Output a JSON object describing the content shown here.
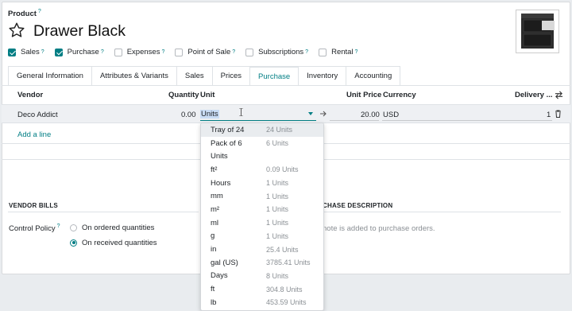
{
  "header": {
    "product_label": "Product",
    "help_mark": "?",
    "title": "Drawer Black"
  },
  "options": [
    {
      "label": "Sales",
      "checked": true
    },
    {
      "label": "Purchase",
      "checked": true
    },
    {
      "label": "Expenses",
      "checked": false
    },
    {
      "label": "Point of Sale",
      "checked": false
    },
    {
      "label": "Subscriptions",
      "checked": false
    },
    {
      "label": "Rental",
      "checked": false
    }
  ],
  "tabs": [
    "General Information",
    "Attributes & Variants",
    "Sales",
    "Prices",
    "Purchase",
    "Inventory",
    "Accounting"
  ],
  "active_tab": "Purchase",
  "table": {
    "headers": {
      "vendor": "Vendor",
      "quantity": "Quantity",
      "unit": "Unit",
      "unit_price": "Unit Price",
      "currency": "Currency",
      "delivery": "Delivery ..."
    },
    "row": {
      "vendor": "Deco Addict",
      "quantity": "0.00",
      "unit": "Units",
      "unit_price": "20.00",
      "currency": "USD",
      "delivery": "1"
    },
    "add_line": "Add a line"
  },
  "vendor_bills": {
    "title": "VENDOR BILLS",
    "control_policy_label": "Control Policy",
    "options": [
      "On ordered quantities",
      "On received quantities"
    ],
    "selected": "On received quantities"
  },
  "purchase_description": {
    "title_visible": "CHASE DESCRIPTION",
    "note_visible": "note is added to purchase orders."
  },
  "unit_dropdown": [
    {
      "name": "Tray of 24",
      "note": "24 Units"
    },
    {
      "name": "Pack of 6",
      "note": "6 Units"
    },
    {
      "name": "Units",
      "note": ""
    },
    {
      "name": "ft²",
      "note": "0.09 Units"
    },
    {
      "name": "Hours",
      "note": "1 Units"
    },
    {
      "name": "mm",
      "note": "1 Units"
    },
    {
      "name": "m²",
      "note": "1 Units"
    },
    {
      "name": "ml",
      "note": "1 Units"
    },
    {
      "name": "g",
      "note": "1 Units"
    },
    {
      "name": "in",
      "note": "25.4 Units"
    },
    {
      "name": "gal (US)",
      "note": "3785.41 Units"
    },
    {
      "name": "Days",
      "note": "8 Units"
    },
    {
      "name": "ft",
      "note": "304.8 Units"
    },
    {
      "name": "lb",
      "note": "453.59 Units"
    }
  ],
  "colors": {
    "accent": "#017e84",
    "highlight": "#c9dcf5"
  }
}
